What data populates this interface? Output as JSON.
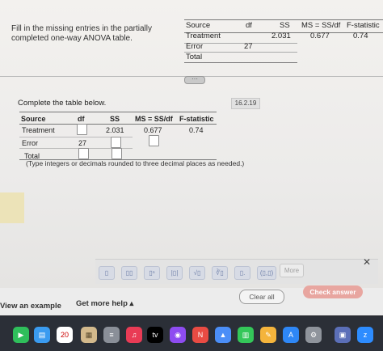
{
  "prompt": {
    "line1": "Fill in the missing entries in the partially",
    "line2": "completed one-way ANOVA table."
  },
  "top_table": {
    "headers": [
      "Source",
      "df",
      "SS",
      "MS = SS/df",
      "F-statistic"
    ],
    "rows": [
      {
        "source": "Treatment",
        "df": "",
        "ss": "2.031",
        "ms": "0.677",
        "f": "0.74"
      },
      {
        "source": "Error",
        "df": "27",
        "ss": "",
        "ms": "",
        "f": ""
      },
      {
        "source": "Total",
        "df": "",
        "ss": "",
        "ms": "",
        "f": ""
      }
    ]
  },
  "work": {
    "complete_label": "Complete the table below.",
    "question_id": "16.2.19",
    "headers": [
      "Source",
      "df",
      "SS",
      "MS = SS/df",
      "F-statistic"
    ],
    "rows": [
      {
        "source": "Treatment",
        "df": "",
        "ss": "2.031",
        "ms": "0.677",
        "f": "0.74"
      },
      {
        "source": "Error",
        "df": "27",
        "ss": "",
        "ms": "",
        "f": ""
      },
      {
        "source": "Total",
        "df": "",
        "ss": "",
        "ms": "",
        "f": ""
      }
    ],
    "instruction": "(Type integers or decimals rounded to three decimal places as needed.)"
  },
  "toolbar": {
    "buttons": [
      "▯",
      "▯▯",
      "▯ⁿ",
      "|▯|",
      "√▯",
      "∛▯",
      "▯.",
      "(▯,▯)"
    ],
    "more_label": "More"
  },
  "footer": {
    "view_example": "View an example",
    "get_help": "Get more help ▴",
    "clear_all": "Clear all",
    "check_answer": "Check answer"
  },
  "dock": {
    "calendar_date": "20"
  }
}
